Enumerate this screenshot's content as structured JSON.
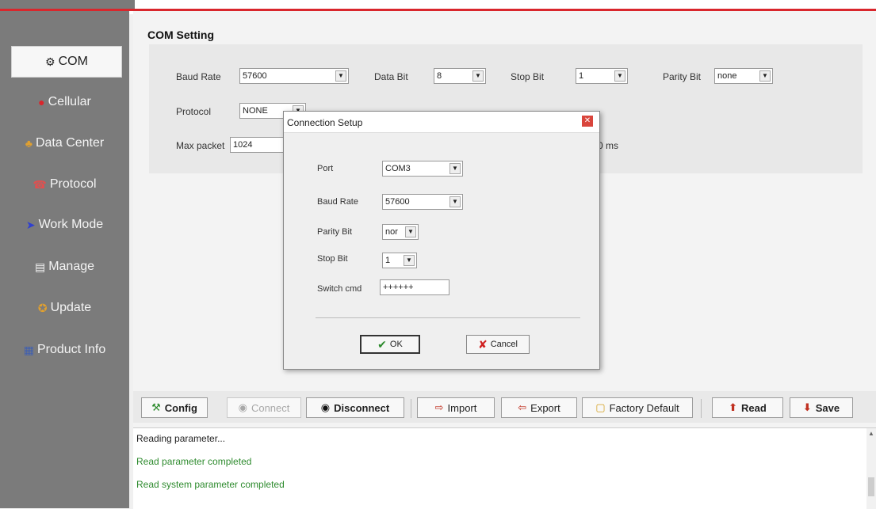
{
  "sidebar": {
    "items": [
      {
        "label": "COM",
        "icon": "com-icon",
        "active": true
      },
      {
        "label": "Cellular",
        "icon": "cellular-icon"
      },
      {
        "label": "Data Center",
        "icon": "data-center-icon"
      },
      {
        "label": "Protocol",
        "icon": "protocol-icon"
      },
      {
        "label": "Work Mode",
        "icon": "work-mode-icon"
      },
      {
        "label": "Manage",
        "icon": "manage-icon"
      },
      {
        "label": "Update",
        "icon": "update-icon"
      },
      {
        "label": "Product Info",
        "icon": "product-info-icon"
      }
    ]
  },
  "com_setting": {
    "title": "COM Setting",
    "baud_rate_label": "Baud Rate",
    "baud_rate_value": "57600",
    "data_bit_label": "Data Bit",
    "data_bit_value": "8",
    "stop_bit_label": "Stop Bit",
    "stop_bit_value": "1",
    "parity_bit_label": "Parity Bit",
    "parity_bit_value": "none",
    "protocol_label": "Protocol",
    "protocol_value": "NONE",
    "max_packet_label": "Max packet",
    "max_packet_value": "1024",
    "partial_suffix": "0 ms"
  },
  "dialog": {
    "title": "Connection Setup",
    "port_label": "Port",
    "port_value": "COM3",
    "baud_rate_label": "Baud Rate",
    "baud_rate_value": "57600",
    "parity_bit_label": "Parity Bit",
    "parity_bit_value": "nor",
    "stop_bit_label": "Stop Bit",
    "stop_bit_value": "1",
    "switch_cmd_label": "Switch cmd",
    "switch_cmd_value": "++++++",
    "ok_label": "OK",
    "cancel_label": "Cancel"
  },
  "toolbar": {
    "config": "Config",
    "connect": "Connect",
    "disconnect": "Disconnect",
    "import": "Import",
    "export": "Export",
    "factory_default": "Factory Default",
    "read": "Read",
    "save": "Save"
  },
  "log": {
    "lines": [
      {
        "text": "Reading parameter...",
        "color": "#222222"
      },
      {
        "text": "Read parameter completed",
        "color": "#2e8b2e"
      },
      {
        "text": "Read system parameter completed",
        "color": "#2e8b2e"
      }
    ]
  },
  "colors": {
    "accent_red": "#d9262c",
    "sidebar_bg": "#7b7b7b",
    "success_green": "#2e8b2e"
  }
}
